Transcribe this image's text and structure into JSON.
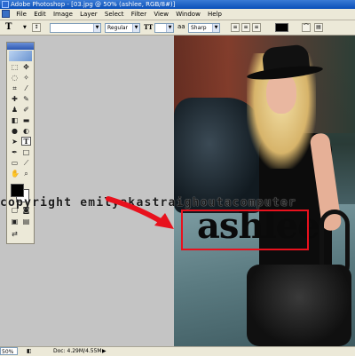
{
  "window": {
    "title": "Adobe Photoshop - [03.jpg @ 50% (ashlee, RGB/8#)]"
  },
  "menu": {
    "items": [
      "File",
      "Edit",
      "Image",
      "Layer",
      "Select",
      "Filter",
      "View",
      "Window",
      "Help"
    ]
  },
  "options": {
    "tool_glyph": "T",
    "font_style": "Regular",
    "antialias": "Sharp"
  },
  "toolbox": {
    "active_tool_glyph": "T",
    "foreground_color": "#000000",
    "background_color": "#ffffff"
  },
  "canvas": {
    "watermark": "copyright emilyakastraighoutacomputer",
    "layer_text": "ashlee"
  },
  "annotation": {
    "arrow_color": "#e8111d",
    "box_color": "#e8111d"
  },
  "status": {
    "zoom": "50%",
    "doc_info": "Doc: 4.29M/4.55M"
  }
}
